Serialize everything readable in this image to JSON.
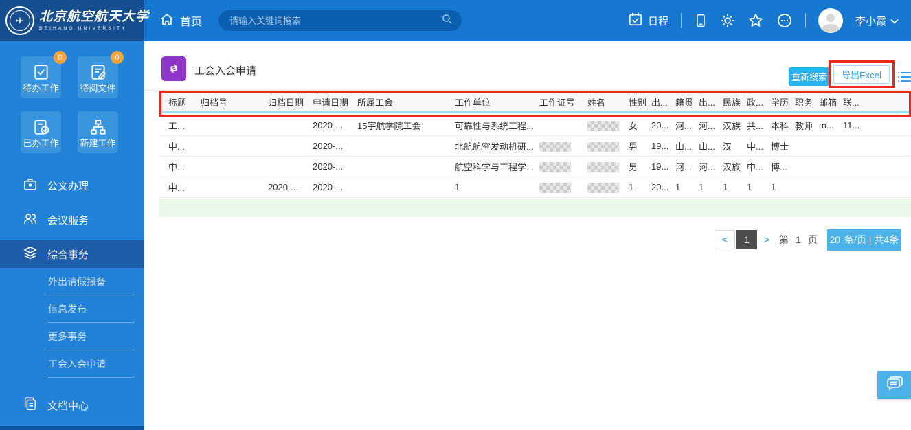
{
  "header": {
    "logo_title": "北京航空航天大学",
    "logo_subtitle": "BEIHANG UNIVERSITY",
    "home_label": "首页",
    "search_placeholder": "请输入关键词搜索",
    "schedule_label": "日程",
    "user_name": "李小霞"
  },
  "sidebar": {
    "tiles": [
      {
        "label": "待办工作",
        "badge": "0"
      },
      {
        "label": "待阅文件",
        "badge": "0"
      },
      {
        "label": "已办工作"
      },
      {
        "label": "新建工作"
      }
    ],
    "menu": [
      {
        "label": "公文办理"
      },
      {
        "label": "会议服务"
      },
      {
        "label": "综合事务",
        "active": true
      },
      {
        "label": "文档中心"
      }
    ],
    "submenu": [
      "外出请假报备",
      "信息发布",
      "更多事务",
      "工会入会申请"
    ]
  },
  "main": {
    "page_title": "工会入会申请",
    "research_button": "重新搜索",
    "export_button": "导出Excel"
  },
  "table": {
    "columns": [
      "标题",
      "归档号",
      "归档日期",
      "申请日期",
      "所属工会",
      "工作单位",
      "工作证号",
      "姓名",
      "性别",
      "出...",
      "籍贯",
      "出...",
      "民族",
      "政...",
      "学历",
      "职务",
      "邮箱",
      "联..."
    ],
    "rows": [
      {
        "cells": [
          "工...",
          "",
          "",
          "2020-...",
          "15宇航学院工会",
          "可靠性与系统工程...",
          "",
          "[blur]",
          "女",
          "20...",
          "河...",
          "河...",
          "汉族",
          "共...",
          "本科",
          "教师",
          "m...",
          "11..."
        ]
      },
      {
        "cells": [
          "中...",
          "",
          "",
          "2020-...",
          "",
          "北航航空发动机研...",
          "[blur]",
          "[blur]",
          "男",
          "19...",
          "山...",
          "山...",
          "汉",
          "中...",
          "博士",
          "",
          "",
          ""
        ]
      },
      {
        "cells": [
          "中...",
          "",
          "",
          "2020-...",
          "",
          "航空科学与工程学...",
          "[blur]",
          "[blur]",
          "男",
          "19...",
          "河...",
          "河...",
          "汉族",
          "中...",
          "博...",
          "",
          "",
          ""
        ]
      },
      {
        "cells": [
          "中...",
          "",
          "2020-...",
          "2020-...",
          "",
          "1",
          "[blur]",
          "[blur]",
          "1",
          "20...",
          "1",
          "1",
          "1",
          "1",
          "1",
          "",
          "",
          ""
        ]
      }
    ]
  },
  "pagination": {
    "prev": "<",
    "current_page": "1",
    "next": ">",
    "page_prefix": "第",
    "page_number": "1",
    "page_suffix": "页",
    "per_page": "20",
    "per_page_label": "条/页 | 共4条"
  },
  "colors": {
    "header_blue": "#1778d2",
    "logo_dark_blue": "#174e8f",
    "sidebar_blue": "#2282d8",
    "active_menu_blue": "#1d5da9",
    "tile_blue": "#3a95df",
    "badge_orange": "#f2a33c",
    "title_purple": "#8d36c9",
    "button_blue": "#29b1ee",
    "pagination_blue": "#4cb2ea",
    "annotation_red": "#e8291c",
    "green_row": "#e9f8e9"
  }
}
